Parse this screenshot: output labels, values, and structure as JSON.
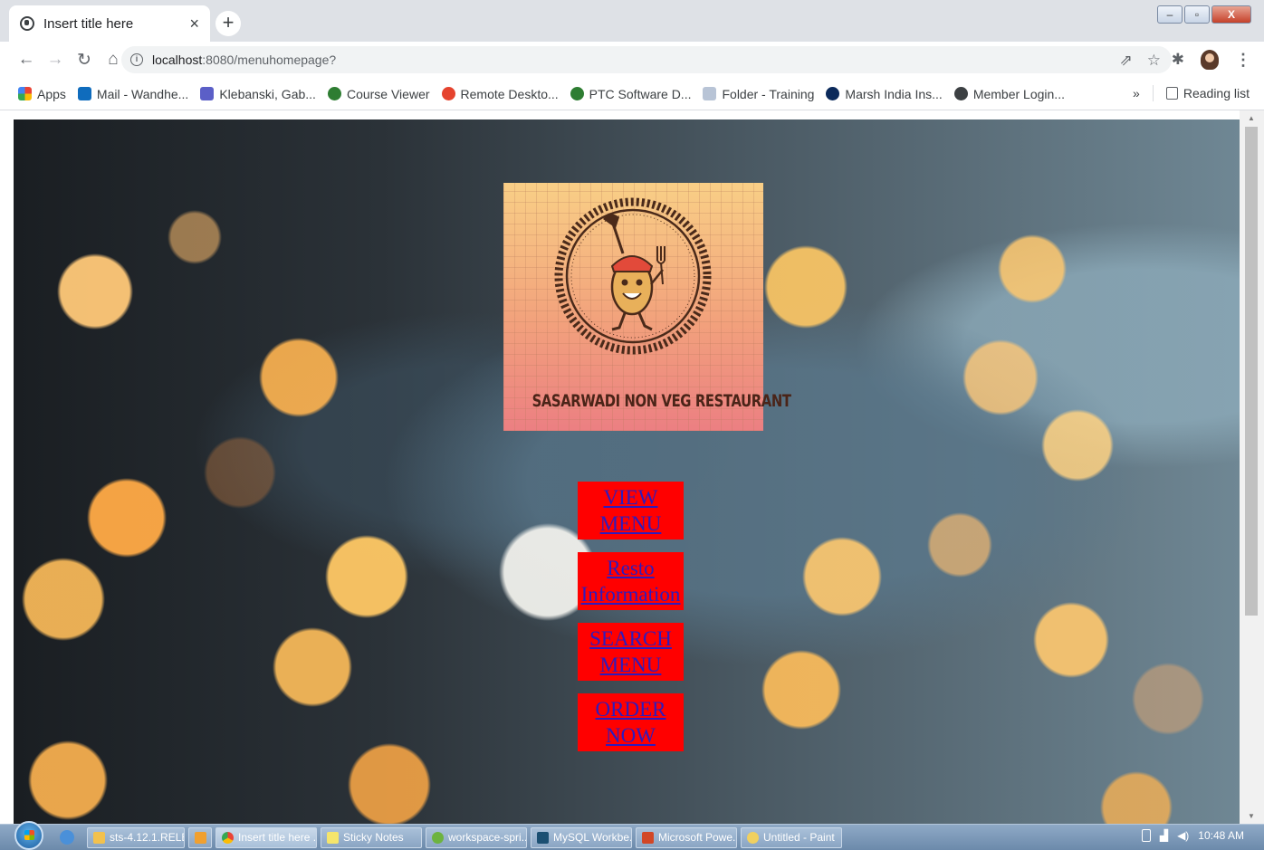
{
  "browser": {
    "tab_title": "Insert title here",
    "tab_close": "×",
    "new_tab": "+",
    "url_host": "localhost",
    "url_path": ":8080/menuhomepage?",
    "window_buttons": {
      "minimize": "–",
      "maximize": "▫",
      "close": "X"
    }
  },
  "bookmarks": {
    "items": [
      {
        "label": "Apps",
        "color": "#ea4335"
      },
      {
        "label": "Mail - Wandhe...",
        "color": "#0f6cbd"
      },
      {
        "label": "Klebanski, Gab...",
        "color": "#5b5fc7"
      },
      {
        "label": "Course Viewer",
        "color": "#2e7d32"
      },
      {
        "label": "Remote Deskto...",
        "color": "#e5432e"
      },
      {
        "label": "PTC Software D...",
        "color": "#2e7d32"
      },
      {
        "label": "Folder - Training",
        "color": "#7a8aa3"
      },
      {
        "label": "Marsh India Ins...",
        "color": "#0b2a5b"
      },
      {
        "label": "Member Login...",
        "color": "#3c4043"
      }
    ],
    "overflow": "»",
    "reading_list": "Reading list"
  },
  "page": {
    "logo_text": "SASARWADI NON VEG RESTAURANT",
    "buttons": [
      {
        "line1": "VIEW",
        "line2": "MENU"
      },
      {
        "line1": "Resto",
        "line2": "Information"
      },
      {
        "line1": "SEARCH",
        "line2": "MENU"
      },
      {
        "line1": "ORDER",
        "line2": "NOW"
      }
    ]
  },
  "taskbar": {
    "items": [
      {
        "label": "sts-4.12.1.RELEA...",
        "color": "#f2c14e"
      },
      {
        "label": "",
        "color": "#f0a030"
      },
      {
        "label": "Insert title here ...",
        "color": "#ea4335"
      },
      {
        "label": "Sticky Notes",
        "color": "#f5e56b"
      },
      {
        "label": "workspace-spri...",
        "color": "#6db33f"
      },
      {
        "label": "MySQL Workbe...",
        "color": "#1b4f72"
      },
      {
        "label": "Microsoft Powe...",
        "color": "#d24726"
      },
      {
        "label": "Untitled - Paint",
        "color": "#f0d060"
      }
    ],
    "clock": "10:48 AM"
  },
  "colors": {
    "button_bg": "#ff0000",
    "button_text": "#2e1bbd"
  }
}
